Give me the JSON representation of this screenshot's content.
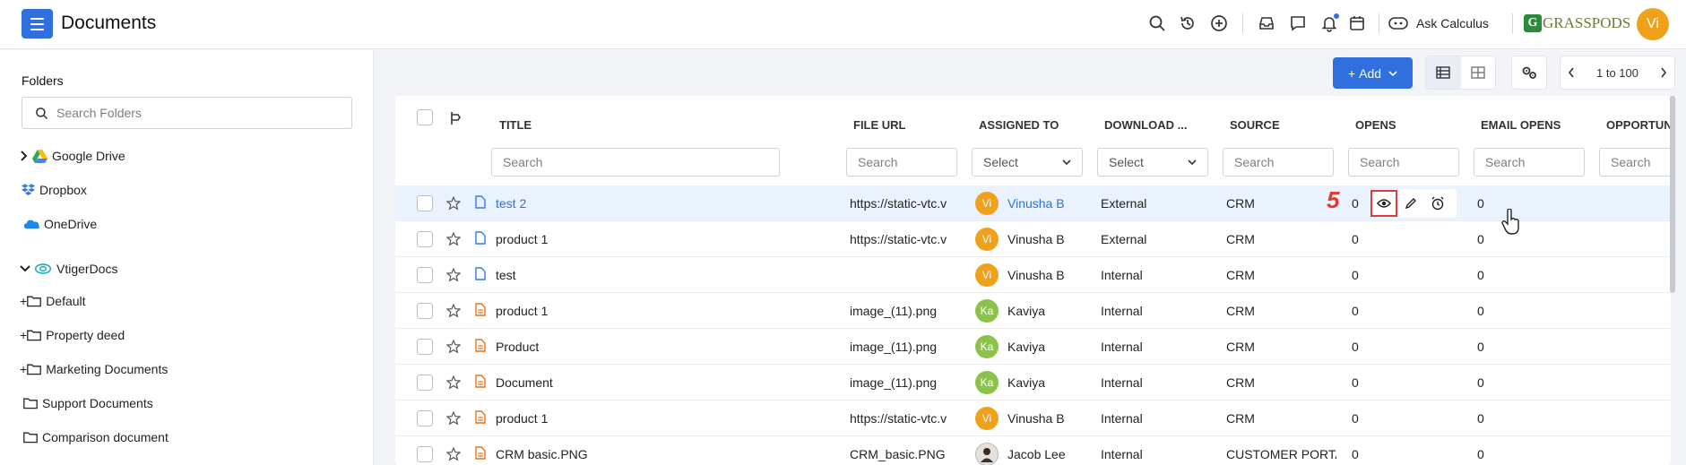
{
  "header": {
    "title": "Documents",
    "ask_label": "Ask Calculus",
    "logo_letter": "G",
    "logo_text": "GRASSPODS",
    "user_initials": "Vi",
    "accent": "#2f6fde"
  },
  "sidebar": {
    "heading": "Folders",
    "search_placeholder": "Search Folders",
    "items": [
      {
        "label": "Google Drive",
        "icon": "google-drive-icon"
      },
      {
        "label": "Dropbox",
        "icon": "dropbox-icon"
      },
      {
        "label": "OneDrive",
        "icon": "onedrive-icon"
      },
      {
        "label": "VtigerDocs",
        "icon": "vtiger-docs-icon"
      },
      {
        "label": "Default",
        "icon": "folder-icon"
      },
      {
        "label": "Property deed",
        "icon": "folder-icon"
      },
      {
        "label": "Marketing Documents",
        "icon": "folder-icon"
      },
      {
        "label": "Support Documents",
        "icon": "folder-icon"
      },
      {
        "label": "Comparison document",
        "icon": "folder-icon"
      }
    ]
  },
  "toolbar": {
    "add_label": "Add",
    "pager_label": "1 to 100"
  },
  "table": {
    "columns": [
      "TITLE",
      "FILE URL",
      "ASSIGNED TO",
      "DOWNLOAD ...",
      "SOURCE",
      "OPENS",
      "EMAIL OPENS",
      "OPPORTUN"
    ],
    "filters": {
      "search_placeholder": "Search",
      "select_placeholder": "Select"
    },
    "rows": [
      {
        "title": "test 2",
        "url": "https://static-vtc.v",
        "initials": "Vi",
        "assigned": "Vinusha B",
        "download": "External",
        "source": "CRM",
        "opens": "0",
        "email_opens": "0"
      },
      {
        "title": "product 1",
        "url": "https://static-vtc.v",
        "initials": "Vi",
        "assigned": "Vinusha B",
        "download": "External",
        "source": "CRM",
        "opens": "0",
        "email_opens": "0"
      },
      {
        "title": "test",
        "url": "",
        "initials": "Vi",
        "assigned": "Vinusha B",
        "download": "Internal",
        "source": "CRM",
        "opens": "0",
        "email_opens": "0"
      },
      {
        "title": "product 1",
        "url": "image_(11).png",
        "initials": "Ka",
        "assigned": "Kaviya",
        "download": "Internal",
        "source": "CRM",
        "opens": "0",
        "email_opens": "0"
      },
      {
        "title": "Product",
        "url": "image_(11).png",
        "initials": "Ka",
        "assigned": "Kaviya",
        "download": "Internal",
        "source": "CRM",
        "opens": "0",
        "email_opens": "0"
      },
      {
        "title": "Document",
        "url": "image_(11).png",
        "initials": "Ka",
        "assigned": "Kaviya",
        "download": "Internal",
        "source": "CRM",
        "opens": "0",
        "email_opens": "0"
      },
      {
        "title": "product 1",
        "url": "https://static-vtc.v",
        "initials": "Vi",
        "assigned": "Vinusha B",
        "download": "Internal",
        "source": "CRM",
        "opens": "0",
        "email_opens": "0"
      },
      {
        "title": "CRM basic.PNG",
        "url": "CRM_basic.PNG",
        "initials": "",
        "assigned": "Jacob Lee",
        "download": "Internal",
        "source": "CUSTOMER PORTAL",
        "opens": "0",
        "email_opens": "0"
      }
    ],
    "step_marker": "5"
  }
}
